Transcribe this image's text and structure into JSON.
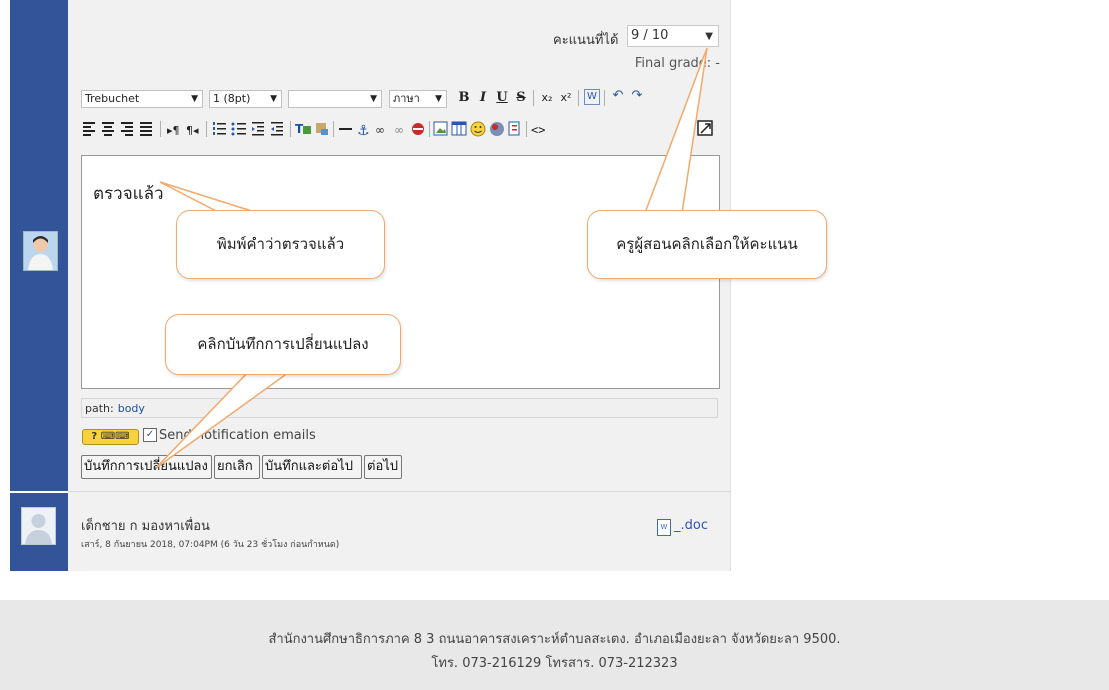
{
  "grade": {
    "label": "คะแนนที่ได้",
    "value": "9 / 10",
    "final_grade": "Final grade: -"
  },
  "editor": {
    "font_family": "Trebuchet",
    "font_size": "1 (8pt)",
    "heading": "",
    "language": "ภาษา",
    "toolbar_row1": {
      "bold": "B",
      "italic": "I",
      "underline": "U",
      "strike": "S",
      "subscript": "x₂",
      "superscript": "x²",
      "paste_word": "W",
      "undo": "↶",
      "redo": "↷"
    },
    "toolbar_row2_icons": [
      "align-left-icon",
      "align-center-icon",
      "align-right-icon",
      "justify-icon",
      "ltr-icon",
      "rtl-icon",
      "ordered-list-icon",
      "unordered-list-icon",
      "outdent-icon",
      "indent-icon",
      "text-color-icon",
      "background-color-icon",
      "horizontal-rule-icon",
      "anchor-icon",
      "link-icon",
      "unlink-icon",
      "nolink-icon",
      "image-icon",
      "table-icon",
      "smiley-icon",
      "special-char-icon",
      "search-replace-icon",
      "html-source-icon",
      "fullscreen-icon"
    ],
    "content": "ตรวจแล้ว",
    "path_label": "path:",
    "path_value": "body"
  },
  "notify": {
    "checked": true,
    "label": "Send notification emails"
  },
  "buttons": {
    "save": "บันทึกการเปลี่ยนแปลง",
    "cancel": "ยกเลิก",
    "save_next": "บันทึกและต่อไป",
    "next": "ต่อไป"
  },
  "submission": {
    "student_name": "เด็กชาย ก มองหาเพื่อน",
    "submitted_time": "เสาร์, 8 กันยายน 2018, 07:04PM (6 วัน 23 ชั่วโมง ก่อนกำหนด)",
    "file_name": "_.doc"
  },
  "callouts": {
    "type_checked": "พิมพ์คำว่าตรวจแล้ว",
    "teacher_select": "ครูผู้สอนคลิกเลือกให้คะแนน",
    "click_save": "คลิกบันทึกการเปลี่ยนแปลง"
  },
  "footer": {
    "line1": "สำนักงานศึกษาธิการภาค 8 3 ถนนอาคารสงเคราะห์ตำบลสะเตง. อำเภอเมืองยะลา จังหวัดยะลา 9500.",
    "line2": "โทร. 073-216129 โทรสาร. 073-212323"
  },
  "colors": {
    "left_strip": "#34549a",
    "panel": "#f1f1f1",
    "callout_border": "#f2a96b",
    "link": "#2a57a8"
  }
}
